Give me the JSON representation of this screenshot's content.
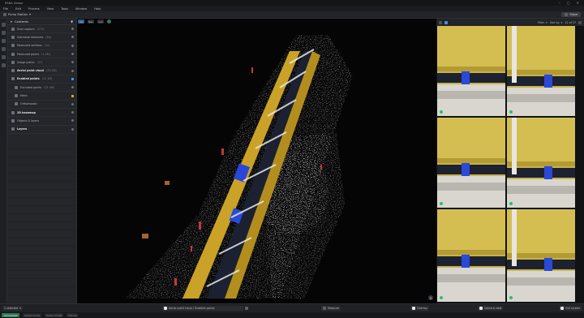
{
  "window": {
    "title": "RSNA Viewer",
    "minimize": "–",
    "maximize": "▢",
    "close": "✕"
  },
  "menu": [
    "File",
    "Edit",
    "Process",
    "View",
    "Tools",
    "Window",
    "Help"
  ],
  "toolbar": {
    "project": "Pump Station",
    "share_label": "Share"
  },
  "sidebar": {
    "title": "Contents",
    "layers": [
      {
        "name": "Scan capture",
        "sub": "(271)",
        "bold": false,
        "ctrl": "dot"
      },
      {
        "name": "Individual elements",
        "sub": "(84)",
        "bold": false,
        "ctrl": "dot"
      },
      {
        "name": "Measured sections",
        "sub": "(12)",
        "bold": false,
        "ctrl": "dot"
      },
      {
        "name": "Measured points",
        "sub": "(1.2M)",
        "bold": false,
        "ctrl": "dot"
      },
      {
        "name": "Image points",
        "sub": "(37)",
        "bold": false,
        "ctrl": "dot"
      },
      {
        "name": "Aerial point cloud",
        "sub": "(33.5M)",
        "bold": true,
        "ctrl": "dot"
      },
      {
        "name": "Enabled points",
        "sub": "(12.1M)",
        "bold": true,
        "ctrl": "blue"
      },
      {
        "name": "Excluded points",
        "sub": "(21.4M)",
        "bold": false,
        "ctrl": "dot",
        "sub_row": true
      },
      {
        "name": "Mesh",
        "sub": "",
        "bold": false,
        "ctrl": "yellow",
        "sub_row": true
      },
      {
        "name": "Orthomosaic",
        "sub": "",
        "bold": false,
        "ctrl": "dot",
        "sub_row": true
      },
      {
        "name": "2D basemap",
        "sub": "",
        "bold": true,
        "ctrl": "dot"
      },
      {
        "name": "Objects & layers",
        "sub": "",
        "bold": false,
        "ctrl": "dot"
      },
      {
        "name": "Layers",
        "sub": "",
        "bold": true,
        "ctrl": "dot"
      }
    ]
  },
  "viewport": {
    "tools": [
      "Sel",
      "Nav",
      "Cut"
    ]
  },
  "photos": {
    "filter_label": "Filter",
    "sort_label": "Sort by",
    "count_label": "12 of 37"
  },
  "bottombar": {
    "layer_select": "1 selected",
    "path": "Aerial point cloud / Enabled points",
    "measure": "Measure",
    "overlay": "Overlay",
    "camera": "Camera view",
    "full": "Full screen"
  },
  "status": {
    "badge": "Connected",
    "items": [
      "Saved 10:26",
      "Points 33.5M",
      "FPS 60"
    ]
  }
}
